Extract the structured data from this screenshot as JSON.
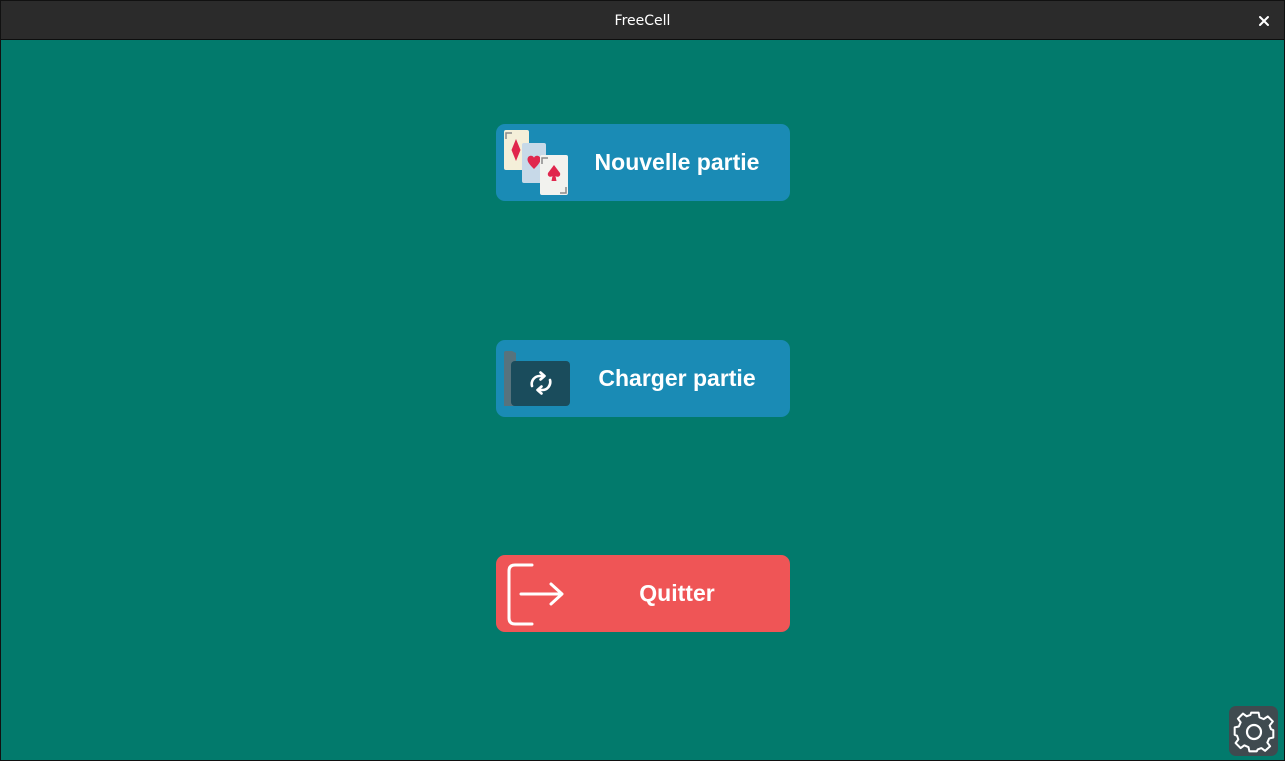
{
  "window": {
    "title": "FreeCell",
    "close_symbol": "✕"
  },
  "menu": {
    "new_game": {
      "label": "Nouvelle partie",
      "icon": "playing-cards-icon"
    },
    "load_game": {
      "label": "Charger partie",
      "icon": "folder-reload-icon"
    },
    "quit": {
      "label": "Quitter",
      "icon": "exit-arrow-icon"
    }
  },
  "settings": {
    "icon": "gear-icon"
  },
  "colors": {
    "background": "#027a6c",
    "titlebar": "#2b2b2b",
    "primary_button": "#1a8bb5",
    "quit_button": "#ef5556",
    "settings_button": "#3f4a4f"
  }
}
